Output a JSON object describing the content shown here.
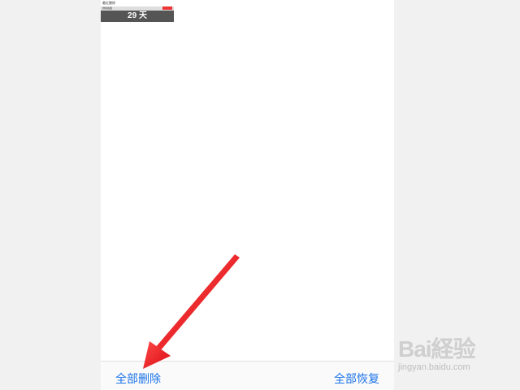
{
  "thumbnail": {
    "title": "最近删除",
    "row_text": "微信截图",
    "days_label": "29 天",
    "left_small": "",
    "right_small": ""
  },
  "toolbar": {
    "delete_all_label": "全部删除",
    "recover_all_label": "全部恢复"
  },
  "watermark": {
    "logo_text": "Bai経验",
    "sub_text": "jingyan.baidu.com"
  },
  "colors": {
    "accent": "#1a73e8",
    "arrow": "#e8141b",
    "background": "#f1f1f1",
    "screen": "#ffffff"
  }
}
